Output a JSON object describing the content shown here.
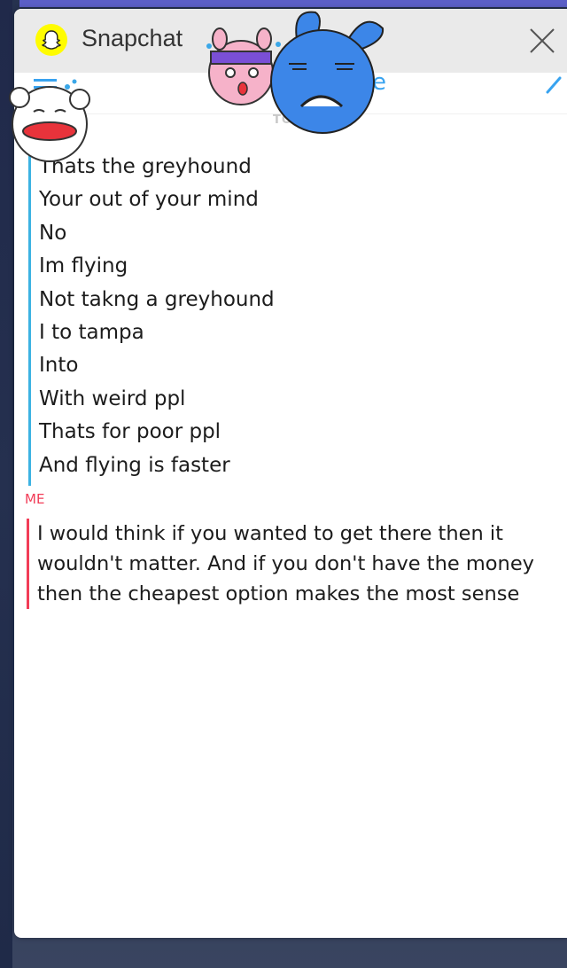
{
  "window": {
    "app_title": "Snapchat",
    "app_icon": "snapchat-ghost-icon",
    "close_icon": "close-icon"
  },
  "nav": {
    "menu_icon": "menu-icon",
    "title_fragment": "e",
    "edit_icon": "edit-icon"
  },
  "chat": {
    "date_label": "TODAY",
    "incoming_messages": [
      "Thats the greyhound",
      "Your out of your mind",
      "No",
      "Im flying",
      "Not takng a greyhound",
      "I to tampa",
      "Into",
      "With weird ppl",
      "Thats for poor ppl",
      "And flying is faster"
    ],
    "me_label": "ME",
    "outgoing_message": "I would think if you wanted to get there then it wouldn't matter. And if you don't have the money then the cheapest option makes the most sense"
  },
  "colors": {
    "incoming_accent": "#3cb2e2",
    "outgoing_accent": "#f23c57",
    "snapchat_yellow": "#fffc00",
    "nav_blue": "#38a3f0"
  },
  "stickers": [
    "laughing-bear-sticker",
    "pink-headband-sticker",
    "blue-crying-bunny-sticker"
  ]
}
